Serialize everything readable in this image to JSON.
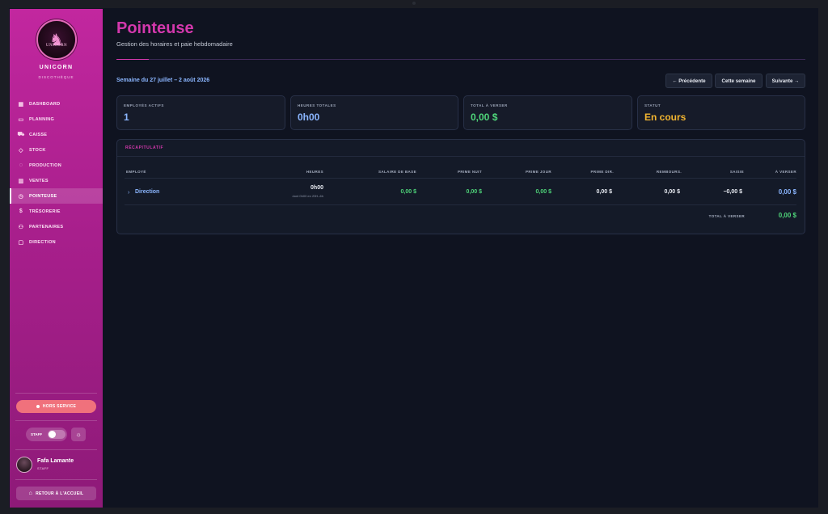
{
  "sidebar": {
    "logo_text": "UNICORN",
    "brand": "UNICORN",
    "brand_sub": "DISCOTHÈQUE",
    "items": [
      {
        "label": "DASHBOARD",
        "icon": "grid-icon"
      },
      {
        "label": "PLANNING",
        "icon": "calendar-icon"
      },
      {
        "label": "CAISSE",
        "icon": "cart-icon"
      },
      {
        "label": "STOCK",
        "icon": "box-icon"
      },
      {
        "label": "PRODUCTION",
        "icon": "flame-icon"
      },
      {
        "label": "VENTES",
        "icon": "bar-chart-icon"
      },
      {
        "label": "POINTEUSE",
        "icon": "clock-icon",
        "active": true
      },
      {
        "label": "TRÉSORERIE",
        "icon": "dollar-icon"
      },
      {
        "label": "PARTENAIRES",
        "icon": "users-icon"
      },
      {
        "label": "DIRECTION",
        "icon": "briefcase-icon"
      }
    ],
    "status_button": "HORS SERVICE",
    "staff_label": "STAFF",
    "user_name": "Fafa Lamante",
    "user_role": "STAFF",
    "back_button": "RETOUR À L'ACCUEIL"
  },
  "header": {
    "title": "Pointeuse",
    "subtitle": "Gestion des horaires et paie hebdomadaire"
  },
  "week": {
    "label": "Semaine du 27 juillet – 2 août 2026",
    "prev": "← Précédente",
    "current": "Cette semaine",
    "next": "Suivante →"
  },
  "stats": [
    {
      "label": "EMPLOYÉS ACTIFS",
      "value": "1",
      "color": "#8bb6ff"
    },
    {
      "label": "HEURES TOTALES",
      "value": "0h00",
      "color": "#8bb6ff"
    },
    {
      "label": "TOTAL À VERSER",
      "value": "0,00 $",
      "color": "#4fd67a"
    },
    {
      "label": "STATUT",
      "value": "En cours",
      "color": "#f2b530"
    }
  ],
  "recap": {
    "title": "RÉCAPITULATIF",
    "headers": {
      "employe": "EMPLOYÉ",
      "heures": "HEURES",
      "salaire": "SALAIRE DE BASE",
      "prime_nuit": "PRIME NUIT",
      "prime_jour": "PRIME JOUR",
      "prime_dir": "PRIME DIR.",
      "rembours": "REMBOURS.",
      "saisie": "SAISIE",
      "a_verser": "À VERSER"
    },
    "row": {
      "employe": "Direction",
      "heures": "0h00",
      "heures_note": "dont 0h00 en 20H–6h",
      "salaire": "0,00 $",
      "prime_nuit": "0,00 $",
      "prime_jour": "0,00 $",
      "prime_dir": "0,00 $",
      "rembours": "0,00 $",
      "saisie": "−0,00 $",
      "a_verser": "0,00 $"
    },
    "total_label": "TOTAL À VERSER",
    "total_value": "0,00 $"
  }
}
